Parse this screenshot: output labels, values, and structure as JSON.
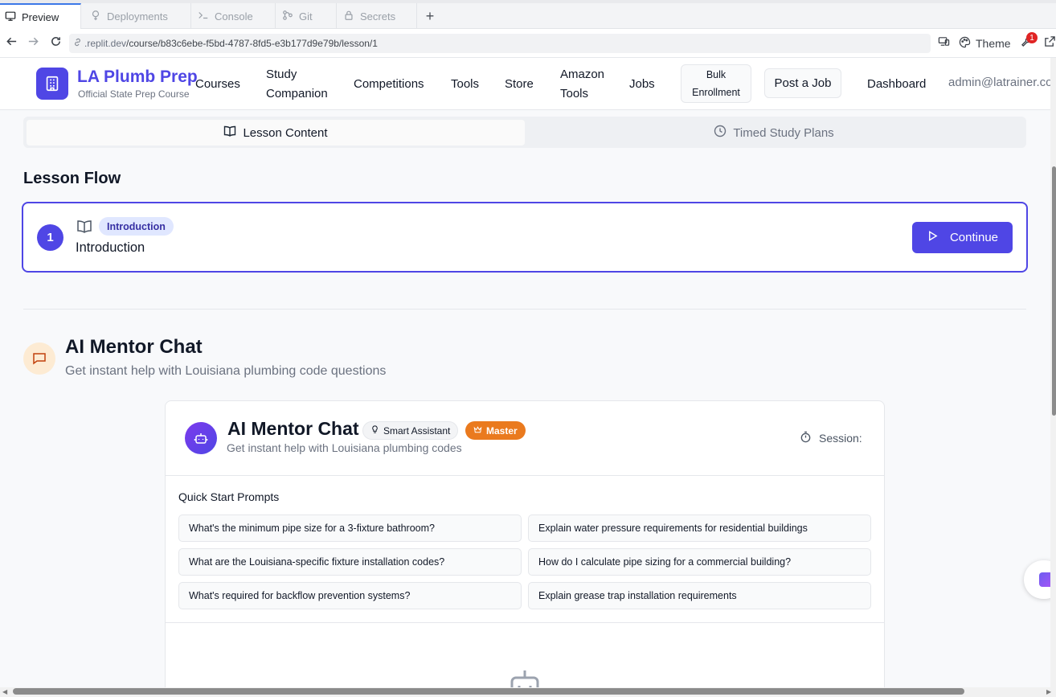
{
  "browser": {
    "tabs": [
      {
        "label": "Preview",
        "icon": "monitor-icon"
      },
      {
        "label": "Deployments",
        "icon": "deploy-icon"
      },
      {
        "label": "Console",
        "icon": "terminal-icon"
      },
      {
        "label": "Git",
        "icon": "git-icon"
      },
      {
        "label": "Secrets",
        "icon": "lock-icon"
      }
    ],
    "url_host": ".replit.dev",
    "url_path": "/course/b83c6ebe-f5bd-4787-8fd5-e3b177d9e79b/lesson/1",
    "theme_label": "Theme",
    "notification_count": "1"
  },
  "header": {
    "brand_title": "LA Plumb Prep",
    "brand_subtitle": "Official State Prep Course",
    "nav": {
      "courses": "Courses",
      "study_line1": "Study",
      "study_line2": "Companion",
      "competitions": "Competitions",
      "tools": "Tools",
      "store": "Store",
      "amazon_line1": "Amazon",
      "amazon_line2": "Tools",
      "jobs": "Jobs",
      "bulk_line1": "Bulk",
      "bulk_line2": "Enrollment",
      "post_job": "Post a Job",
      "dashboard": "Dashboard"
    },
    "user_email": "admin@latrainer.co"
  },
  "content_tabs": {
    "lesson_content": "Lesson Content",
    "timed_study_plans": "Timed Study Plans"
  },
  "lesson_flow": {
    "title": "Lesson Flow",
    "steps": [
      {
        "number": "1",
        "badge": "Introduction",
        "name": "Introduction",
        "action": "Continue"
      }
    ]
  },
  "mentor_section": {
    "title": "AI Mentor Chat",
    "subtitle": "Get instant help with Louisiana plumbing code questions"
  },
  "chat": {
    "title": "AI Mentor Chat",
    "badge_smart": "Smart Assistant",
    "badge_master": "Master",
    "subtitle": "Get instant help with Louisiana plumbing codes",
    "session_label": "Session:",
    "quick_start_label": "Quick Start Prompts",
    "prompts": [
      "What's the minimum pipe size for a 3-fixture bathroom?",
      "Explain water pressure requirements for residential buildings",
      "What are the Louisiana-specific fixture installation codes?",
      "How do I calculate pipe sizing for a commercial building?",
      "What's required for backflow prevention systems?",
      "Explain grease trap installation requirements"
    ]
  },
  "colors": {
    "brand": "#4f46e5",
    "master_badge": "#ea7a1e",
    "mentor_icon_bg": "#fdebd3"
  }
}
